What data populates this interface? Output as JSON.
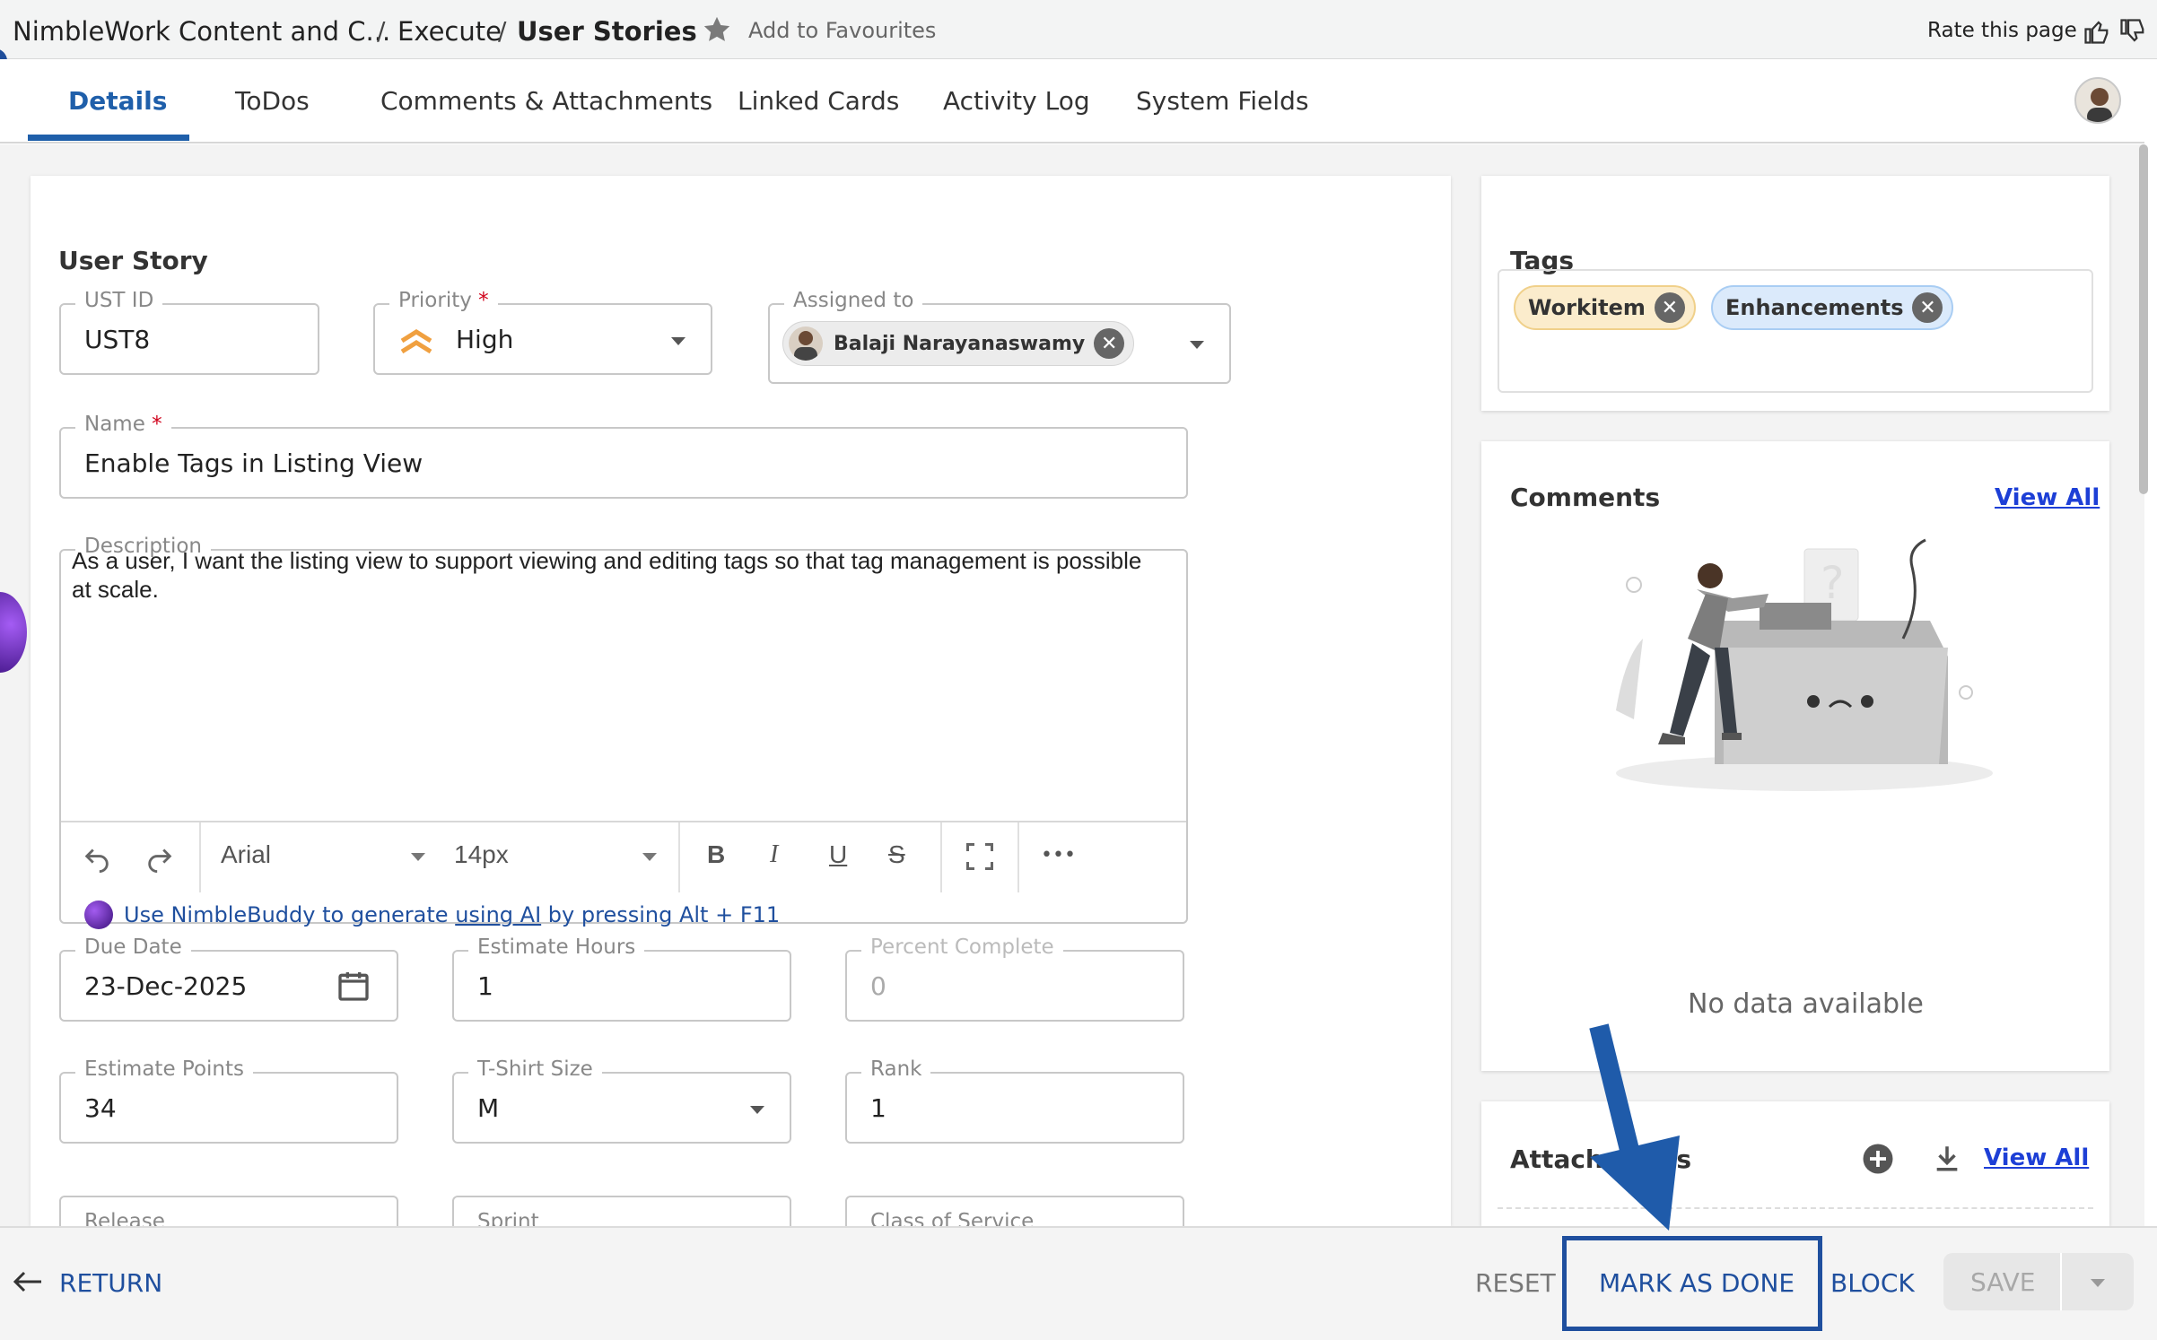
{
  "breadcrumb": {
    "app": "NimbleWork Content and C...",
    "sep": "/",
    "section": "Execute",
    "current": "User Stories"
  },
  "header": {
    "favourite_label": "Add to Favourites",
    "rate_label": "Rate this page"
  },
  "tabs": [
    {
      "label": "Details",
      "active": true
    },
    {
      "label": "ToDos"
    },
    {
      "label": "Comments & Attachments"
    },
    {
      "label": "Linked Cards"
    },
    {
      "label": "Activity Log"
    },
    {
      "label": "System Fields"
    }
  ],
  "form": {
    "title": "User Story",
    "ust_id": {
      "label": "UST ID",
      "value": "UST8"
    },
    "priority": {
      "label": "Priority",
      "required": "*",
      "value": "High"
    },
    "assigned_to": {
      "label": "Assigned to",
      "value": "Balaji Narayanaswamy"
    },
    "name": {
      "label": "Name",
      "required": "*",
      "value": "Enable Tags in Listing View"
    },
    "description": {
      "label": "Description",
      "value": "As a user, I want the listing view to support viewing and editing tags so that tag management is possible at scale."
    },
    "editor_toolbar": {
      "font": "Arial",
      "size": "14px",
      "bold": "B",
      "italic": "I",
      "underline": "U",
      "strike": "S",
      "more": "•••"
    },
    "ai_hint": {
      "prefix": "Use NimbleBuddy to generate",
      "link": "using AI",
      "suffix": "by pressing Alt + F11"
    },
    "due_date": {
      "label": "Due Date",
      "value": "23-Dec-2025"
    },
    "estimate_hours": {
      "label": "Estimate Hours",
      "value": "1"
    },
    "percent_complete": {
      "label": "Percent Complete",
      "value": "0"
    },
    "estimate_points": {
      "label": "Estimate Points",
      "value": "34"
    },
    "tshirt_size": {
      "label": "T-Shirt Size",
      "value": "M"
    },
    "rank": {
      "label": "Rank",
      "value": "1"
    },
    "release": {
      "label": "Release"
    },
    "sprint": {
      "label": "Sprint"
    },
    "class_of_service": {
      "label": "Class of Service"
    }
  },
  "tags": {
    "title": "Tags",
    "items": [
      {
        "label": "Workitem",
        "color": "#fbeccc",
        "border": "#f0d08a"
      },
      {
        "label": "Enhancements",
        "color": "#dbeafb",
        "border": "#a9cdf3"
      }
    ]
  },
  "comments": {
    "title": "Comments",
    "view_all": "View All",
    "empty": "No data available"
  },
  "attachments": {
    "title": "Attachments",
    "view_all": "View All"
  },
  "bottom": {
    "return": "RETURN",
    "reset": "RESET",
    "mark_done": "MARK AS DONE",
    "block": "BLOCK",
    "save": "SAVE"
  },
  "colors": {
    "accent": "#1f5faa",
    "link": "#1d3fd6",
    "highlight": "#1f4f9e"
  }
}
